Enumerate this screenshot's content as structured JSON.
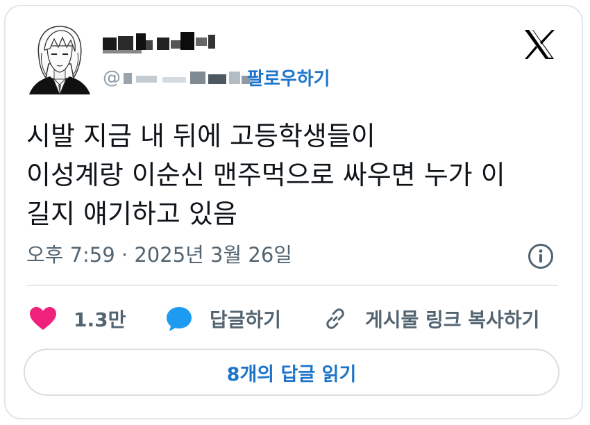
{
  "colors": {
    "accent": "#1d75c9",
    "heart": "#f0217b",
    "bubble": "#1d9bf0",
    "muted": "#536471",
    "text": "#0f1419"
  },
  "header": {
    "follow_label": "팔로우하기",
    "handle_prefix": "@",
    "avatar_icon": "anime-avatar-portrait",
    "logo_icon": "x-logo-icon"
  },
  "tweet": {
    "lines": [
      "시발 지금 내 뒤에 고등학생들이",
      "이성계랑 이순신 맨주먹으로 싸우면 누가 이",
      "길지 얘기하고 있음"
    ],
    "timestamp": "오후 7:59 · 2025년 3월 26일"
  },
  "actions": {
    "like_count": "1.3만",
    "reply_label": "답글하기",
    "copy_link_label": "게시물 링크 복사하기"
  },
  "footer": {
    "read_replies_label": "8개의 답글 읽기"
  }
}
